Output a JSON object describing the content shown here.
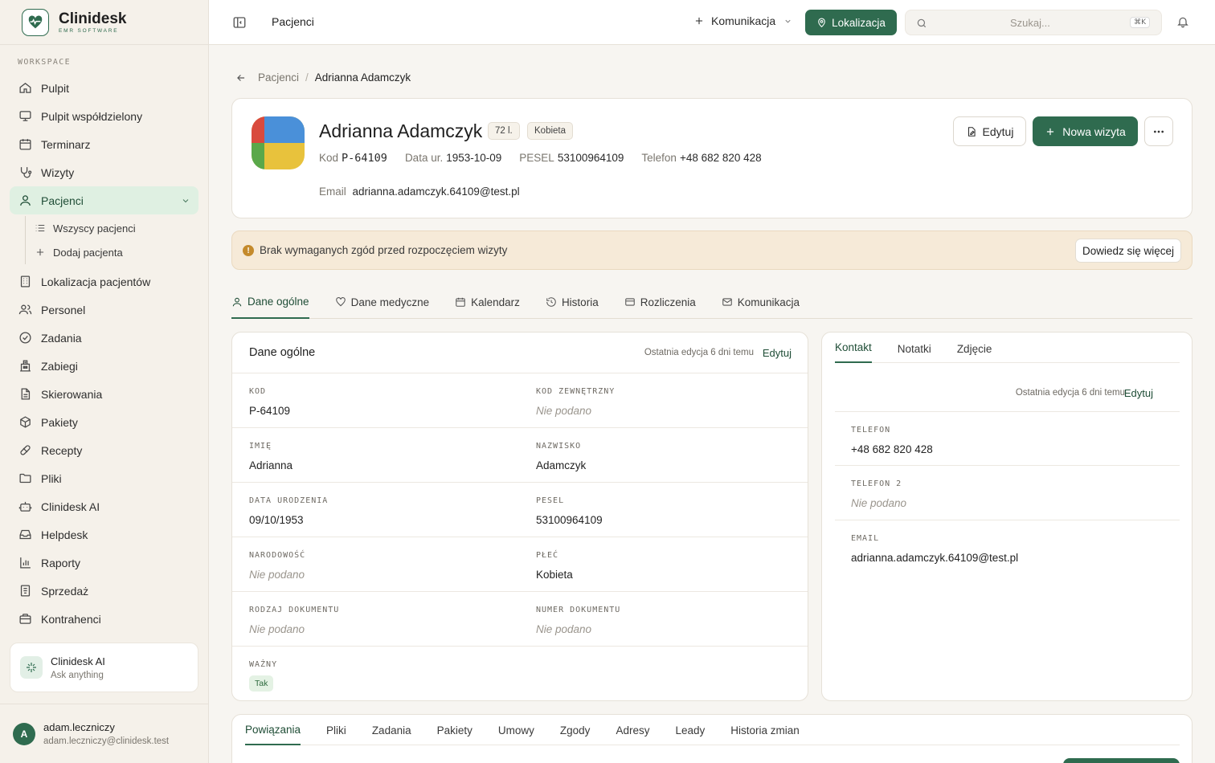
{
  "app": {
    "name": "Clinidesk",
    "subtitle": "EMR SOFTWARE"
  },
  "sidebar": {
    "section_label": "WORKSPACE",
    "items": [
      {
        "label": "Pulpit",
        "icon": "home-icon"
      },
      {
        "label": "Pulpit współdzielony",
        "icon": "monitor-icon"
      },
      {
        "label": "Terminarz",
        "icon": "calendar-icon"
      },
      {
        "label": "Wizyty",
        "icon": "stethoscope-icon"
      },
      {
        "label": "Pacjenci",
        "icon": "user-icon",
        "active": true
      },
      {
        "label": "Lokalizacja pacjentów",
        "icon": "building-icon"
      },
      {
        "label": "Personel",
        "icon": "users-icon"
      },
      {
        "label": "Zadania",
        "icon": "check-circle-icon"
      },
      {
        "label": "Zabiegi",
        "icon": "hospital-icon"
      },
      {
        "label": "Skierowania",
        "icon": "document-icon"
      },
      {
        "label": "Pakiety",
        "icon": "package-icon"
      },
      {
        "label": "Recepty",
        "icon": "pill-icon"
      },
      {
        "label": "Pliki",
        "icon": "folder-icon"
      },
      {
        "label": "Clinidesk AI",
        "icon": "robot-icon"
      },
      {
        "label": "Helpdesk",
        "icon": "inbox-icon"
      },
      {
        "label": "Raporty",
        "icon": "bar-chart-icon"
      },
      {
        "label": "Sprzedaż",
        "icon": "receipt-icon"
      },
      {
        "label": "Kontrahenci",
        "icon": "briefcase-icon"
      }
    ],
    "sub_items": [
      {
        "label": "Wszyscy pacjenci",
        "icon": "list-icon"
      },
      {
        "label": "Dodaj pacjenta",
        "icon": "plus-icon"
      }
    ],
    "ai_card": {
      "title": "Clinidesk AI",
      "subtitle": "Ask anything"
    },
    "user": {
      "initial": "A",
      "name": "adam.leczniczy",
      "email": "adam.leczniczy@clinidesk.test"
    }
  },
  "topbar": {
    "title": "Pacjenci",
    "communication_label": "Komunikacja",
    "location_label": "Lokalizacja",
    "search_placeholder": "Szukaj...",
    "search_shortcut": "⌘K"
  },
  "breadcrumb": {
    "parent": "Pacjenci",
    "current": "Adrianna Adamczyk"
  },
  "patient": {
    "name": "Adrianna Adamczyk",
    "age_badge": "72 l.",
    "gender_badge": "Kobieta",
    "meta": [
      {
        "key": "Kod",
        "value": "P-64109"
      },
      {
        "key": "Data ur.",
        "value": "1953-10-09"
      },
      {
        "key": "PESEL",
        "value": "53100964109"
      },
      {
        "key": "Telefon",
        "value": "+48 682 820 428"
      }
    ],
    "email_key": "Email",
    "email_value": "adrianna.adamczyk.64109@test.pl",
    "edit_label": "Edytuj",
    "new_visit_label": "Nowa wizyta",
    "avatar_colors": [
      "#d94a3d",
      "#4a90d9",
      "#e8c23c",
      "#5aa84a"
    ]
  },
  "alert": {
    "text": "Brak wymaganych zgód przed rozpoczęciem wizyty",
    "button": "Dowiedz się więcej"
  },
  "tabs": [
    {
      "label": "Dane ogólne",
      "icon": "user-icon",
      "active": true
    },
    {
      "label": "Dane medyczne",
      "icon": "heart-icon"
    },
    {
      "label": "Kalendarz",
      "icon": "calendar-icon"
    },
    {
      "label": "Historia",
      "icon": "history-icon"
    },
    {
      "label": "Rozliczenia",
      "icon": "credit-card-icon"
    },
    {
      "label": "Komunikacja",
      "icon": "mail-icon"
    }
  ],
  "general": {
    "title": "Dane ogólne",
    "edited": "Ostatnia edycja 6 dni temu",
    "edit_link": "Edytuj",
    "empty_text": "Nie podano",
    "rows": [
      [
        {
          "label": "KOD",
          "value": "P-64109"
        },
        {
          "label": "KOD ZEWNĘTRZNY",
          "value": "Nie podano",
          "empty": true
        }
      ],
      [
        {
          "label": "IMIĘ",
          "value": "Adrianna"
        },
        {
          "label": "NAZWISKO",
          "value": "Adamczyk"
        }
      ],
      [
        {
          "label": "DATA URODZENIA",
          "value": "09/10/1953"
        },
        {
          "label": "PESEL",
          "value": "53100964109"
        }
      ],
      [
        {
          "label": "NARODOWOŚĆ",
          "value": "Nie podano",
          "empty": true
        },
        {
          "label": "PŁEĆ",
          "value": "Kobieta"
        }
      ],
      [
        {
          "label": "RODZAJ DOKUMENTU",
          "value": "Nie podano",
          "empty": true
        },
        {
          "label": "NUMER DOKUMENTU",
          "value": "Nie podano",
          "empty": true
        }
      ]
    ],
    "valid_label": "WAŻNY",
    "valid_value": "Tak"
  },
  "contact": {
    "tabs": [
      "Kontakt",
      "Notatki",
      "Zdjęcie"
    ],
    "edited": "Ostatnia edycja 6 dni temu",
    "edit_link": "Edytuj",
    "fields": [
      {
        "label": "TELEFON",
        "value": "+48 682 820 428"
      },
      {
        "label": "TELEFON 2",
        "value": "Nie podano",
        "empty": true
      },
      {
        "label": "EMAIL",
        "value": "adrianna.adamczyk.64109@test.pl"
      }
    ]
  },
  "bottom_tabs": [
    "Powiązania",
    "Pliki",
    "Zadania",
    "Pakiety",
    "Umowy",
    "Zgody",
    "Adresy",
    "Leady",
    "Historia zmian"
  ],
  "colors": {
    "accent": "#2f6b4f",
    "active_bg": "#dff0e2",
    "alert_bg": "#f6ead8",
    "alert_icon": "#c48a2c"
  }
}
